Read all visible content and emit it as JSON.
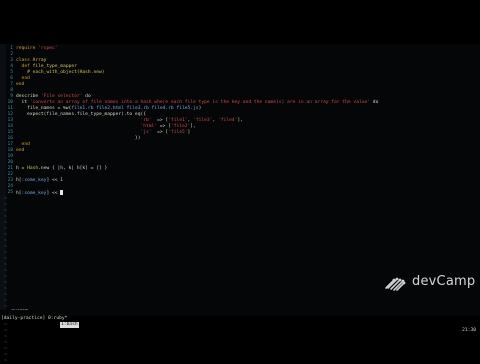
{
  "editor": {
    "lines": [
      {
        "n": "1",
        "segs": [
          [
            "kw",
            "require "
          ],
          [
            "str",
            "'rspec'"
          ]
        ]
      },
      {
        "n": "2",
        "segs": []
      },
      {
        "n": "3",
        "segs": [
          [
            "kw",
            "class "
          ],
          [
            "cls",
            "Array"
          ]
        ]
      },
      {
        "n": "4",
        "segs": [
          [
            "plain",
            "  "
          ],
          [
            "kw",
            "def "
          ],
          [
            "cls",
            "file_type_mapper"
          ]
        ]
      },
      {
        "n": "5",
        "segs": [
          [
            "plain",
            "    "
          ],
          [
            "cls",
            "# each_with_object(Hash.new)"
          ]
        ]
      },
      {
        "n": "6",
        "segs": [
          [
            "plain",
            "  "
          ],
          [
            "kw",
            "end"
          ]
        ]
      },
      {
        "n": "7",
        "segs": [
          [
            "kw",
            "end"
          ]
        ]
      },
      {
        "n": "8",
        "segs": []
      },
      {
        "n": "9",
        "segs": [
          [
            "plain",
            "describe "
          ],
          [
            "str",
            "'File selector'"
          ],
          [
            "plain",
            " do"
          ]
        ]
      },
      {
        "n": "10",
        "segs": [
          [
            "plain",
            "  it "
          ],
          [
            "str",
            "'converts an array of file names into a hash where each file type is the key and the name(s) are in an array for the value'"
          ],
          [
            "plain",
            " do"
          ]
        ]
      },
      {
        "n": "11",
        "segs": [
          [
            "plain",
            "    file_names = %w("
          ],
          [
            "sym",
            "file1.rb file2.html file3.rb file4.rb file5.js"
          ],
          [
            "plain",
            ")"
          ]
        ]
      },
      {
        "n": "12",
        "segs": [
          [
            "plain",
            "    expect(file_names.file_type_mapper).to eq({"
          ]
        ]
      },
      {
        "n": "13",
        "segs": [
          [
            "plain",
            "                                             "
          ],
          [
            "str",
            "'rb'"
          ],
          [
            "plain",
            "  => ["
          ],
          [
            "str",
            "'file1'"
          ],
          [
            "plain",
            ", "
          ],
          [
            "str",
            "'file3'"
          ],
          [
            "plain",
            ", "
          ],
          [
            "str",
            "'file4'"
          ],
          [
            "plain",
            "],"
          ]
        ]
      },
      {
        "n": "14",
        "segs": [
          [
            "plain",
            "                                             "
          ],
          [
            "str",
            "'html'"
          ],
          [
            "plain",
            " => ["
          ],
          [
            "str",
            "'file2'"
          ],
          [
            "plain",
            "],"
          ]
        ]
      },
      {
        "n": "15",
        "segs": [
          [
            "plain",
            "                                             "
          ],
          [
            "str",
            "'js'"
          ],
          [
            "plain",
            "  => ["
          ],
          [
            "str",
            "'file5'"
          ],
          [
            "plain",
            "]"
          ]
        ]
      },
      {
        "n": "16",
        "segs": [
          [
            "plain",
            "                                           })"
          ]
        ]
      },
      {
        "n": "17",
        "segs": [
          [
            "plain",
            "  "
          ],
          [
            "kw",
            "end"
          ]
        ]
      },
      {
        "n": "18",
        "segs": [
          [
            "kw",
            "end"
          ]
        ]
      },
      {
        "n": "19",
        "segs": []
      },
      {
        "n": "20",
        "segs": []
      },
      {
        "n": "21",
        "segs": [
          [
            "plain",
            "h = "
          ],
          [
            "cls",
            "Hash"
          ],
          [
            "plain",
            ".new { |h, k| h[k] = [] }"
          ]
        ]
      },
      {
        "n": "22",
        "segs": []
      },
      {
        "n": "23",
        "segs": [
          [
            "plain",
            "h["
          ],
          [
            "sym",
            ":some_key"
          ],
          [
            "plain",
            "] << 1"
          ]
        ]
      },
      {
        "n": "24",
        "segs": []
      },
      {
        "n": "25",
        "segs": [
          [
            "plain",
            "h["
          ],
          [
            "sym",
            ":some_key"
          ],
          [
            "plain",
            "] << "
          ]
        ],
        "cursor": true
      }
    ],
    "tilde_count": 28
  },
  "status": {
    "mode": "-- INSERT --",
    "session": "[daily-practice] 0:ruby*",
    "active": "1:bash",
    "time": "21:30"
  },
  "brand": {
    "name": "devCamp"
  },
  "colors": {
    "keyword": "#d4a23a",
    "string": "#d24b4b",
    "symbol": "#78a9e0",
    "constant": "#d6c55b",
    "line_number": "#4b8fb3"
  }
}
